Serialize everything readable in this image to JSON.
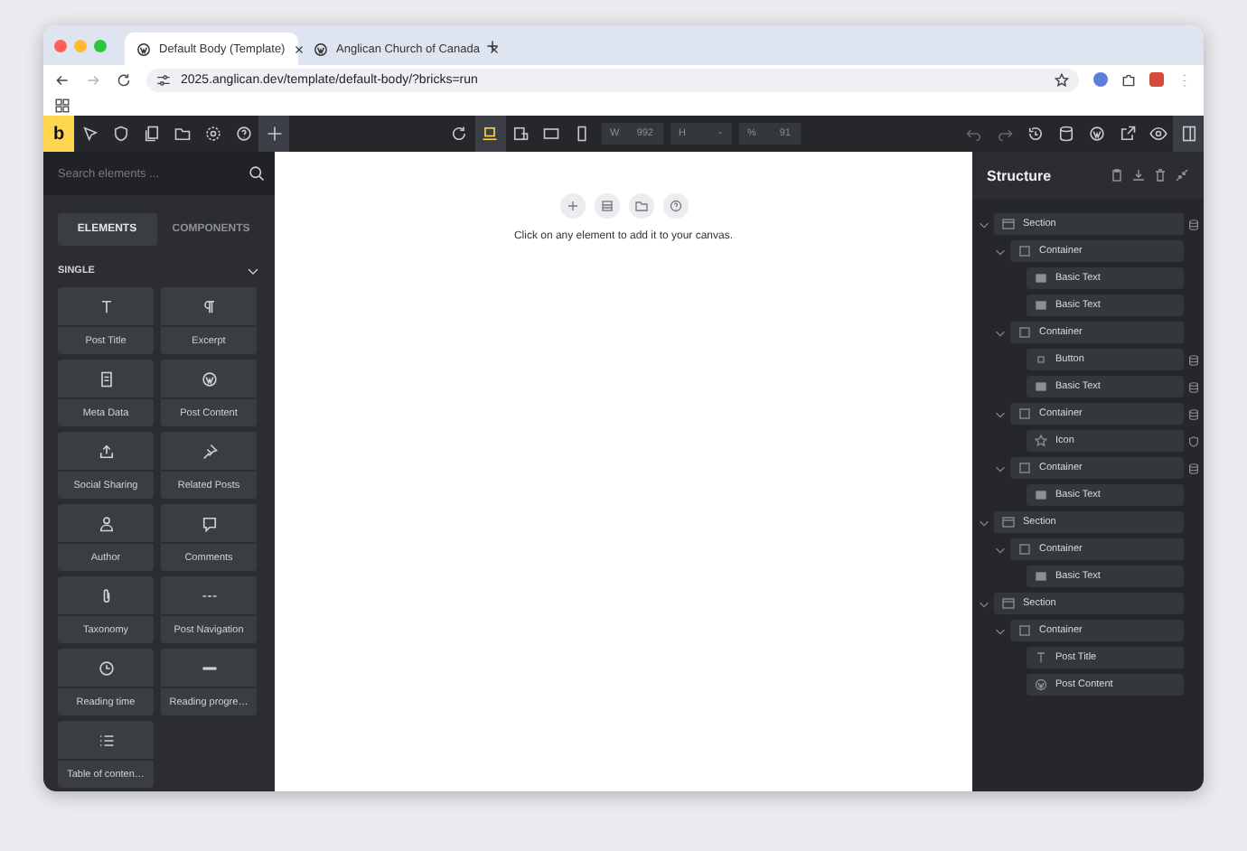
{
  "browser": {
    "tabs": [
      {
        "title": "Default Body (Template)",
        "selected": true
      },
      {
        "title": "Anglican Church of Canada",
        "selected": false
      }
    ],
    "url": "2025.anglican.dev/template/default-body/?bricks=run"
  },
  "toolbar": {
    "logo": "b",
    "breakpoints": [
      {
        "kind": "laptop",
        "selected": true
      },
      {
        "kind": "tablet-landscape",
        "selected": false
      },
      {
        "kind": "tablet",
        "selected": false
      },
      {
        "kind": "phone",
        "selected": false
      }
    ],
    "fields": [
      {
        "label": "W",
        "value": "992"
      },
      {
        "label": "H",
        "value": "-"
      },
      {
        "label": "%",
        "value": "91"
      }
    ]
  },
  "elements_panel": {
    "search": {
      "placeholder": "Search elements ..."
    },
    "tabs": [
      {
        "label": "ELEMENTS",
        "selected": true
      },
      {
        "label": "COMPONENTS",
        "selected": false
      }
    ],
    "category": {
      "label": "SINGLE",
      "expanded": true
    },
    "items": [
      {
        "label": "Post Title",
        "kind": "title"
      },
      {
        "label": "Excerpt",
        "kind": "excerpt"
      },
      {
        "label": "Meta Data",
        "kind": "meta"
      },
      {
        "label": "Post Content",
        "kind": "wp"
      },
      {
        "label": "Social Sharing",
        "kind": "share"
      },
      {
        "label": "Related Posts",
        "kind": "pin"
      },
      {
        "label": "Author",
        "kind": "author"
      },
      {
        "label": "Comments",
        "kind": "comments"
      },
      {
        "label": "Taxonomy",
        "kind": "clip"
      },
      {
        "label": "Post Navigation",
        "kind": "nav"
      },
      {
        "label": "Reading time",
        "kind": "clock"
      },
      {
        "label": "Reading progre…",
        "kind": "progress"
      },
      {
        "label": "Table of conten…",
        "kind": "list"
      }
    ]
  },
  "canvas": {
    "hint": "Click on any element to add it to your canvas."
  },
  "structure": {
    "title": "Structure",
    "tree": [
      {
        "label": "Section",
        "kind": "section",
        "expanded": true,
        "has_conditions": true,
        "children": [
          {
            "label": "Container",
            "kind": "container",
            "expanded": true,
            "children": [
              {
                "label": "Basic Text",
                "kind": "text"
              },
              {
                "label": "Basic Text",
                "kind": "text"
              }
            ]
          },
          {
            "label": "Container",
            "kind": "container",
            "expanded": true,
            "children": [
              {
                "label": "Button",
                "kind": "button",
                "has_conditions": true
              },
              {
                "label": "Basic Text",
                "kind": "text",
                "has_conditions": true
              }
            ]
          },
          {
            "label": "Container",
            "kind": "container",
            "expanded": true,
            "has_conditions": true,
            "children": [
              {
                "label": "Icon",
                "kind": "icon",
                "has_interactions": true
              }
            ]
          },
          {
            "label": "Container",
            "kind": "container",
            "expanded": true,
            "has_conditions": true,
            "children": [
              {
                "label": "Basic Text",
                "kind": "text"
              }
            ]
          }
        ]
      },
      {
        "label": "Section",
        "kind": "section",
        "expanded": true,
        "children": [
          {
            "label": "Container",
            "kind": "container",
            "expanded": true,
            "children": [
              {
                "label": "Basic Text",
                "kind": "text"
              }
            ]
          }
        ]
      },
      {
        "label": "Section",
        "kind": "section",
        "expanded": true,
        "children": [
          {
            "label": "Container",
            "kind": "container",
            "expanded": true,
            "children": [
              {
                "label": "Post Title",
                "kind": "title"
              },
              {
                "label": "Post Content",
                "kind": "wp"
              }
            ]
          }
        ]
      }
    ]
  }
}
